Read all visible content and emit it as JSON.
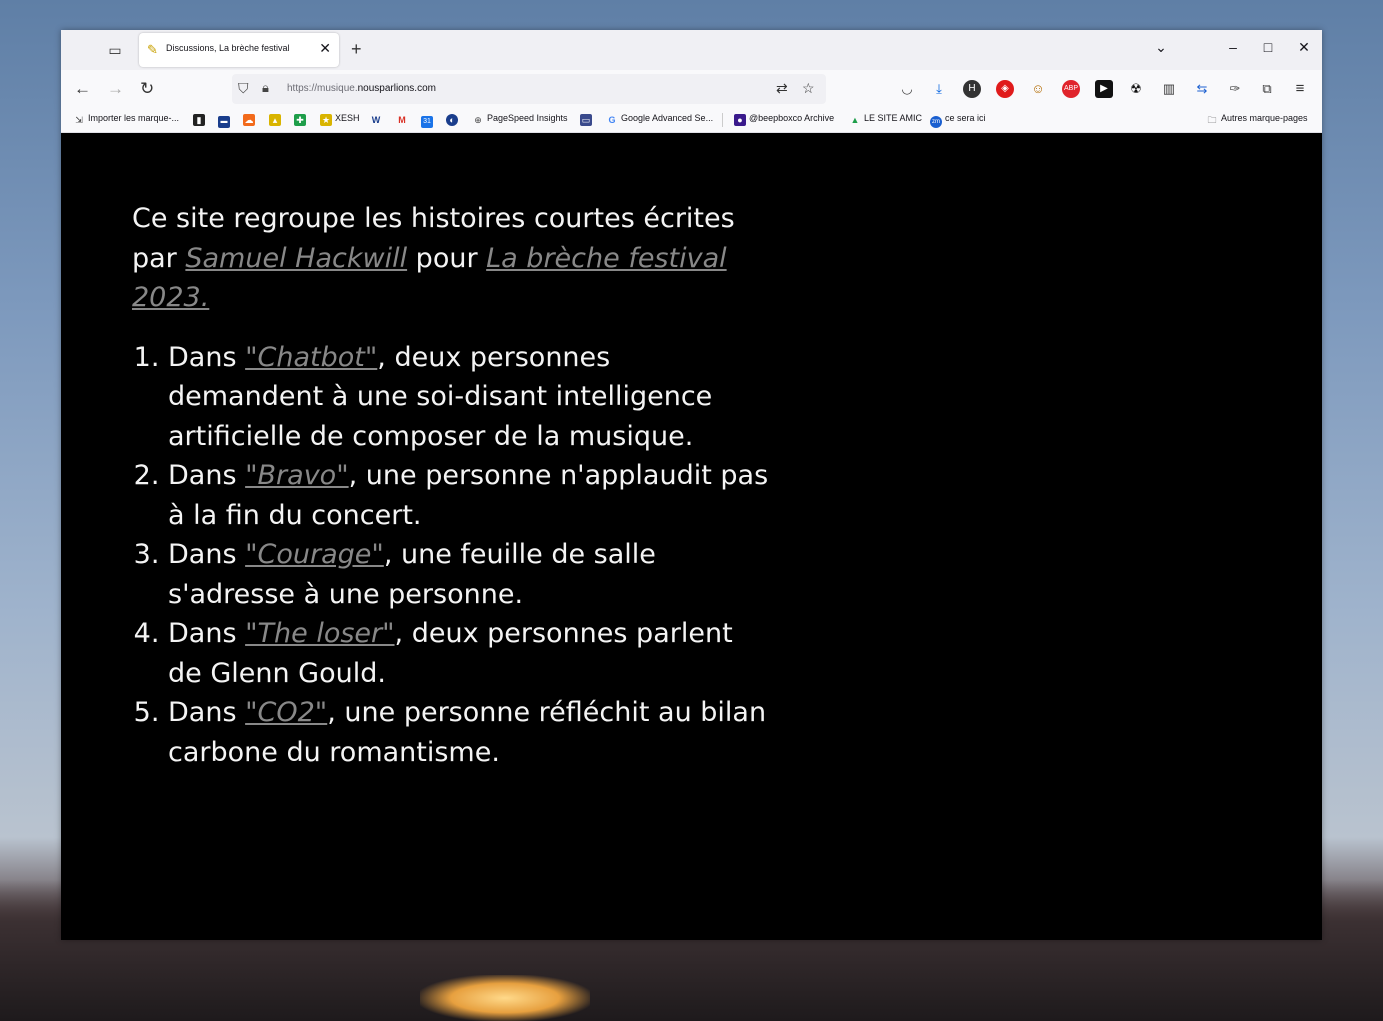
{
  "browser": {
    "tab": {
      "title": "Discussions, La brèche festival"
    },
    "url": {
      "protocol": "https://",
      "subdomain": "musique.",
      "domain": "nousparlions.com"
    },
    "bookmarks": [
      {
        "label": "Importer les marque-..."
      },
      {
        "label": "XESH"
      },
      {
        "label": "PageSpeed Insights"
      },
      {
        "label": "Google Advanced Se..."
      },
      {
        "label": "@beepboxco Archive"
      },
      {
        "label": "LE SITE AMIC"
      },
      {
        "label": "ce sera ici"
      },
      {
        "label": "Autres marque-pages"
      }
    ]
  },
  "page": {
    "intro": {
      "prefix": "Ce site regroupe les histoires courtes écrites par ",
      "author": "Samuel Hackwill",
      "middle": " pour ",
      "festival": "La brèche festival 2023."
    },
    "stories": [
      {
        "lead": "Dans ",
        "title": "\"Chatbot\"",
        "rest": ", deux personnes demandent à une soi-disant intelligence artificielle de composer de la musique."
      },
      {
        "lead": "Dans ",
        "title": "\"Bravo\"",
        "rest": ", une personne n'applaudit pas à la fin du concert."
      },
      {
        "lead": "Dans ",
        "title": "\"Courage\"",
        "rest": ", une feuille de salle s'adresse à une personne."
      },
      {
        "lead": "Dans ",
        "title": "\"The loser\"",
        "rest": ", deux personnes parlent de Glenn Gould."
      },
      {
        "lead": "Dans ",
        "title": "\"CO2\"",
        "rest": ", une personne réfléchit au bilan carbone du romantisme."
      }
    ]
  }
}
